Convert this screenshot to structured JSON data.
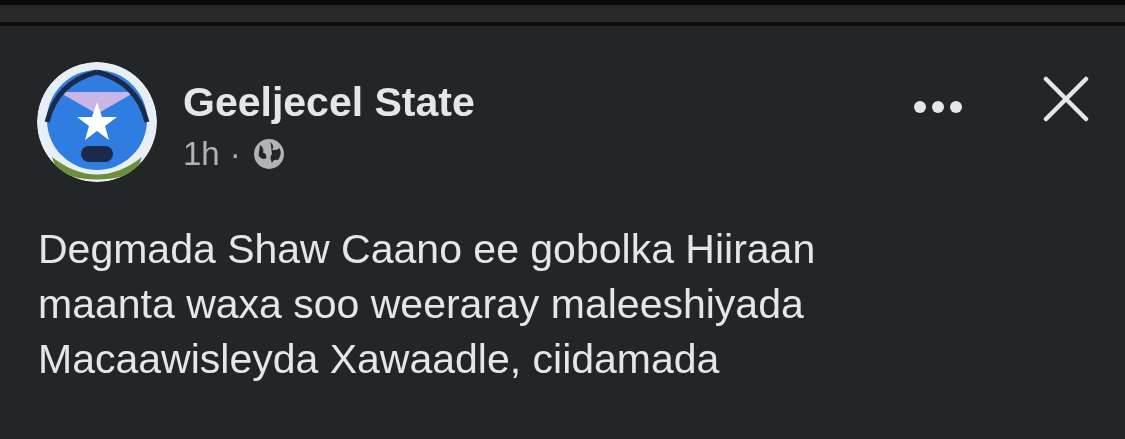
{
  "post": {
    "author": "Geeljecel State",
    "time": "1h",
    "separator": "·",
    "text_lines": [
      "Degmada Shaw Caano ee gobolka Hiiraan",
      "maanta waxa soo weeraray maleeshiyada",
      "Macaawisleyda Xawaadle, ciidamada"
    ]
  }
}
